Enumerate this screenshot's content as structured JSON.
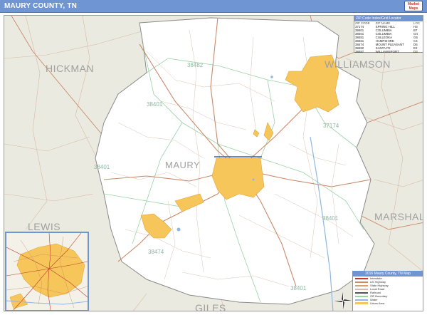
{
  "header": {
    "title": "MAURY COUNTY, TN",
    "logo_text": "Market Maps"
  },
  "map": {
    "county_name": "MAURY",
    "neighbors": [
      "HICKMAN",
      "WILLIAMSON",
      "LEWIS",
      "MARSHALL",
      "GILES"
    ],
    "zip_labels": [
      "38482",
      "38401",
      "38474",
      "37174",
      "38401",
      "38401",
      "38401"
    ],
    "colors": {
      "county_fill": "#ffffff",
      "outside_fill": "#eaeae0",
      "urban_fill": "#f6c65a",
      "urban_stroke": "#e0a63a",
      "county_border": "#8a8a8a",
      "road_major": "#c98a6a",
      "road_minor": "#d9b9a8",
      "zip_boundary": "#9ad3a6",
      "water": "#8fb8e0",
      "header": "#6f95d2"
    }
  },
  "locator": {
    "title": "ZIP Code Index/Grid Locator",
    "columns": [
      "ZIP CODE",
      "ZIP NAME",
      "LOC"
    ],
    "rows": [
      [
        "37174",
        "SPRING HILL",
        "H3"
      ],
      [
        "38401",
        "COLUMBIA",
        "B7"
      ],
      [
        "38401",
        "COLUMBIA",
        "G4"
      ],
      [
        "38451",
        "CULLEOKA",
        "G6"
      ],
      [
        "38461",
        "HAMPSHIRE",
        "C4"
      ],
      [
        "38474",
        "MOUNT PLEASANT",
        "D6"
      ],
      [
        "38482",
        "SANTA FE",
        "E2"
      ],
      [
        "38487",
        "WILLIAMSPORT",
        "D3"
      ]
    ]
  },
  "legend": {
    "title": "2016 Maury County, TN Map",
    "items": [
      {
        "label": "Interstate",
        "color": "#c0392b"
      },
      {
        "label": "US Highway",
        "color": "#c98a6a"
      },
      {
        "label": "State Highway",
        "color": "#d9a070"
      },
      {
        "label": "Local Road",
        "color": "#d9b9a8"
      },
      {
        "label": "Railroad",
        "color": "#555555"
      },
      {
        "label": "ZIP Boundary",
        "color": "#9ad3a6"
      },
      {
        "label": "Water",
        "color": "#8fb8e0"
      },
      {
        "label": "Urban Area",
        "color": "#f6c65a"
      }
    ]
  }
}
